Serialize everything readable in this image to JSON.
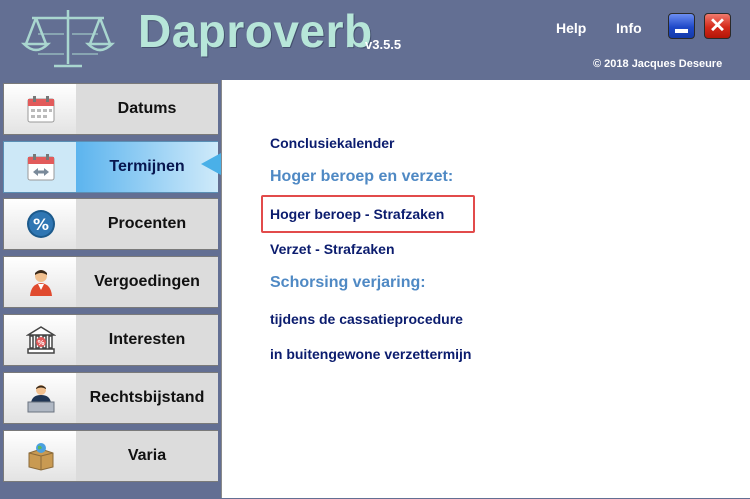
{
  "header": {
    "app_title": "Daproverb",
    "version": "v3.5.5",
    "help_label": "Help",
    "info_label": "Info",
    "copyright": "© 2018 Jacques Deseure",
    "logo_icon": "scales-of-justice-icon",
    "minimize_icon": "minimize-icon",
    "close_icon": "close-icon",
    "close_glyph": "✕"
  },
  "sidebar": {
    "active_index": 1,
    "items": [
      {
        "label": "Datums",
        "icon": "calendar-icon"
      },
      {
        "label": "Termijnen",
        "icon": "calendar-arrows-icon"
      },
      {
        "label": "Procenten",
        "icon": "percent-icon"
      },
      {
        "label": "Vergoedingen",
        "icon": "person-icon"
      },
      {
        "label": "Interesten",
        "icon": "bank-icon"
      },
      {
        "label": "Rechtsbijstand",
        "icon": "lawyer-desk-icon"
      },
      {
        "label": "Varia",
        "icon": "box-globe-icon"
      }
    ]
  },
  "content": {
    "conclusiekalender": "Conclusiekalender",
    "section_hoger_beroep": "Hoger beroep en verzet:",
    "hoger_beroep_strafzaken": "Hoger beroep - Strafzaken",
    "verzet_strafzaken": "Verzet - Strafzaken",
    "section_schorsing": "Schorsing verjaring:",
    "cassatie": "tijdens de cassatieprocedure",
    "verzettermijn": "in buitengewone verzettermijn"
  },
  "colors": {
    "background": "#636f93",
    "title": "#b7e6d9",
    "link": "#0b1c6e",
    "section": "#4f89c4",
    "highlight": "#e24b4b",
    "active_accent": "#4ab0e8"
  }
}
